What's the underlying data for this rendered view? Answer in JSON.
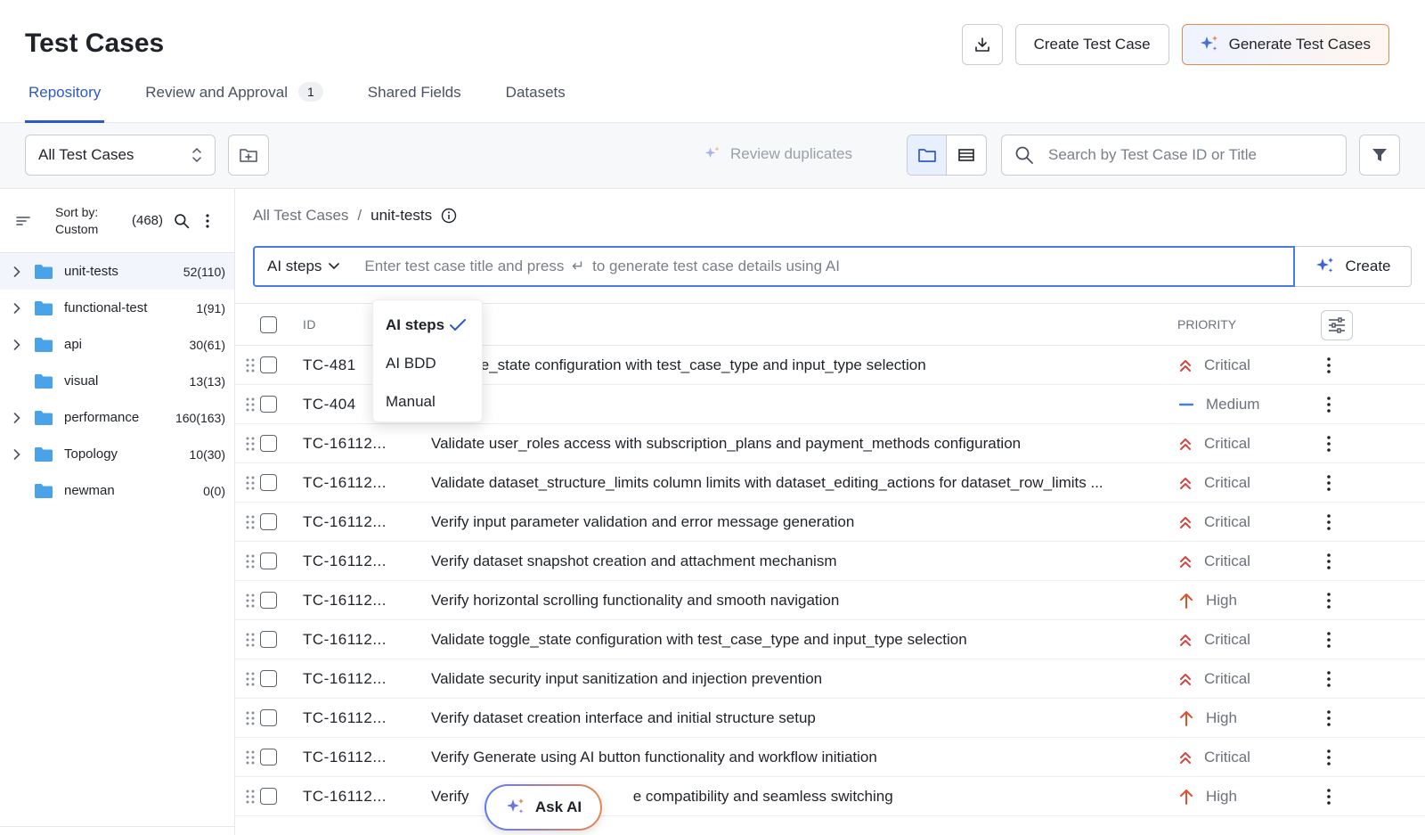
{
  "header": {
    "title": "Test Cases",
    "create_label": "Create Test Case",
    "generate_label": "Generate Test Cases",
    "tabs": [
      {
        "label": "Repository"
      },
      {
        "label": "Review and Approval",
        "badge": "1"
      },
      {
        "label": "Shared Fields"
      },
      {
        "label": "Datasets"
      }
    ]
  },
  "toolbar": {
    "scope_value": "All Test Cases",
    "review_duplicates": "Review duplicates",
    "search_placeholder": "Search by Test Case ID or Title"
  },
  "sidebar": {
    "sort_line1": "Sort by:",
    "sort_line2": "Custom",
    "total": "(468)",
    "folders": [
      {
        "name": "unit-tests",
        "count": "52(110)",
        "expandable": true
      },
      {
        "name": "functional-test",
        "count": "1(91)",
        "expandable": true
      },
      {
        "name": "api",
        "count": "30(61)",
        "expandable": true
      },
      {
        "name": "visual",
        "count": "13(13)",
        "expandable": false
      },
      {
        "name": "performance",
        "count": "160(163)",
        "expandable": true
      },
      {
        "name": "Topology",
        "count": "10(30)",
        "expandable": true
      },
      {
        "name": "newman",
        "count": "0(0)",
        "expandable": false
      }
    ]
  },
  "main": {
    "breadcrumb_root": "All Test Cases",
    "breadcrumb_sep": "/",
    "breadcrumb_current": "unit-tests",
    "mode_value": "AI steps",
    "gen_placeholder_a": "Enter test case title and press",
    "gen_placeholder_b": "to generate test case details using AI",
    "create_label": "Create",
    "columns": {
      "id": "ID",
      "priority": "PRIORITY"
    },
    "rows": [
      {
        "id": "TC-481",
        "title": "te toggle_state configuration with test_case_type and input_type selection",
        "priority": "Critical"
      },
      {
        "id": "TC-404",
        "title": "",
        "priority": "Medium"
      },
      {
        "id": "TC-16112...",
        "title": "Validate user_roles access with subscription_plans and payment_methods configuration",
        "priority": "Critical"
      },
      {
        "id": "TC-16112...",
        "title": "Validate dataset_structure_limits column limits with dataset_editing_actions for dataset_row_limits ...",
        "priority": "Critical"
      },
      {
        "id": "TC-16112...",
        "title": "Verify input parameter validation and error message generation",
        "priority": "Critical"
      },
      {
        "id": "TC-16112...",
        "title": "Verify dataset snapshot creation and attachment mechanism",
        "priority": "Critical"
      },
      {
        "id": "TC-16112...",
        "title": "Verify horizontal scrolling functionality and smooth navigation",
        "priority": "High"
      },
      {
        "id": "TC-16112...",
        "title": "Validate toggle_state configuration with test_case_type and input_type selection",
        "priority": "Critical"
      },
      {
        "id": "TC-16112...",
        "title": "Validate security input sanitization and injection prevention",
        "priority": "Critical"
      },
      {
        "id": "TC-16112...",
        "title": "Verify dataset creation interface and initial structure setup",
        "priority": "High"
      },
      {
        "id": "TC-16112...",
        "title": "Verify Generate using AI button functionality and workflow initiation",
        "priority": "Critical"
      },
      {
        "id": "TC-16112...",
        "title": "Verify                                       e compatibility and seamless switching",
        "priority": "High"
      }
    ]
  },
  "dropdown": {
    "items": [
      {
        "label": "AI steps",
        "selected": true
      },
      {
        "label": "AI BDD",
        "selected": false
      },
      {
        "label": "Manual",
        "selected": false
      }
    ]
  },
  "ask_ai": "Ask AI",
  "colors": {
    "accent": "#2c5bc7",
    "critical": "#d6453d",
    "medium": "#4a7be3",
    "high": "#e0502f",
    "folder": "#4aa3e8"
  }
}
